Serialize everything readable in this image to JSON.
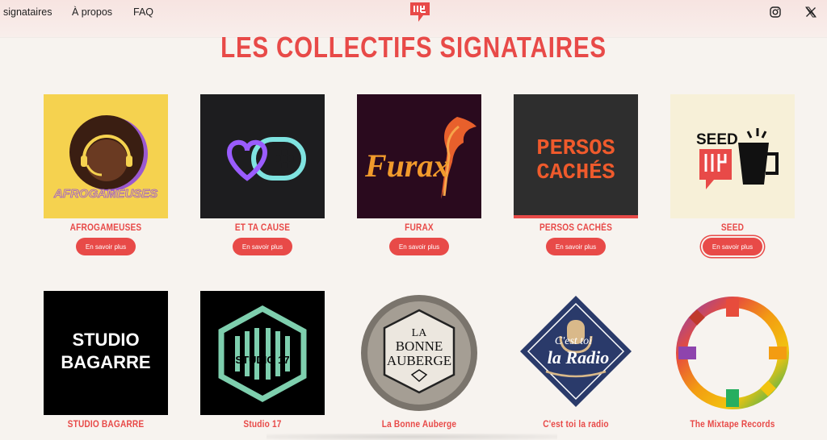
{
  "nav": {
    "links": [
      "signataires",
      "À propos",
      "FAQ"
    ],
    "logo_icon": "collective-logo-icon",
    "social": [
      "instagram-icon",
      "x-icon"
    ],
    "accent": "#e84a48"
  },
  "page_title": "LES COLLECTIFS SIGNATAIRES",
  "button_label": "En savoir plus",
  "collectives": [
    {
      "name": "AFROGAMEUSES",
      "logo_text": "AFROGAMEUSES",
      "bg": "#f5d24f"
    },
    {
      "name": "ET TA CAUSE",
      "bg": "#1d1d1f"
    },
    {
      "name": "FURAX",
      "logo_text": "Furax",
      "bg": "#2a0a1e"
    },
    {
      "name": "PERSOS CACHÉS",
      "logo_text": [
        "PERSOS",
        "CACHÉS"
      ],
      "bg": "#2e2e2e"
    },
    {
      "name": "SEED",
      "logo_text": "SEED",
      "bg": "#f7f0d8"
    },
    {
      "name": "STUDIO BAGARRE",
      "logo_text": [
        "STUDIO",
        "BAGARRE"
      ],
      "bg": "#000000"
    },
    {
      "name": "Studio 17",
      "logo_text": "STUDIO 17",
      "bg": "#000000"
    },
    {
      "name": "La Bonne Auberge",
      "logo_text": [
        "LA",
        "BONNE",
        "AUBERGE"
      ],
      "bg": "#f7f3ef"
    },
    {
      "name": "C'est toi la radio",
      "logo_text": [
        "C'est toi",
        "la Radio"
      ],
      "bg": "#f7f3ef"
    },
    {
      "name": "The Mixtape Records",
      "bg": "#f7f3ef"
    }
  ]
}
